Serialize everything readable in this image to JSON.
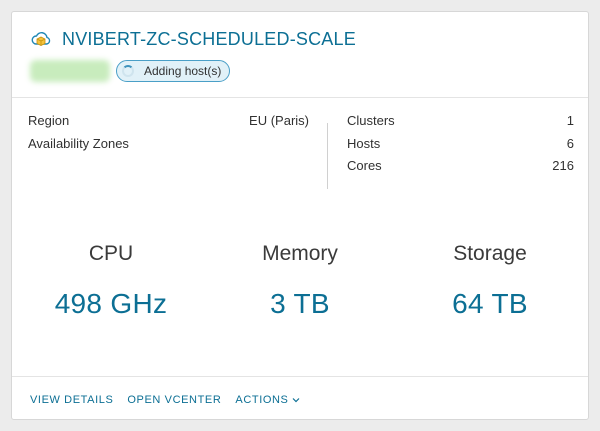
{
  "card": {
    "title": "NVIBERT-ZC-SCHEDULED-SCALE",
    "status_badge": "Adding host(s)",
    "info_left": [
      {
        "label": "Region",
        "value": "EU (Paris)"
      },
      {
        "label": "Availability Zones",
        "value": ""
      }
    ],
    "info_right": [
      {
        "label": "Clusters",
        "value": "1"
      },
      {
        "label": "Hosts",
        "value": "6"
      },
      {
        "label": "Cores",
        "value": "216"
      }
    ],
    "metrics": [
      {
        "label": "CPU",
        "value": "498 GHz"
      },
      {
        "label": "Memory",
        "value": "3 TB"
      },
      {
        "label": "Storage",
        "value": "64 TB"
      }
    ],
    "actions": {
      "view_details": "VIEW DETAILS",
      "open_vcenter": "OPEN VCENTER",
      "actions": "ACTIONS"
    }
  },
  "colors": {
    "accent": "#0c6f94",
    "badge_border": "#4a9fc7",
    "badge_bg": "#e1f1f8"
  },
  "icons": {
    "sddc": "cloud-icon",
    "status": "spinner-icon",
    "actions_menu": "chevron-down-icon"
  }
}
